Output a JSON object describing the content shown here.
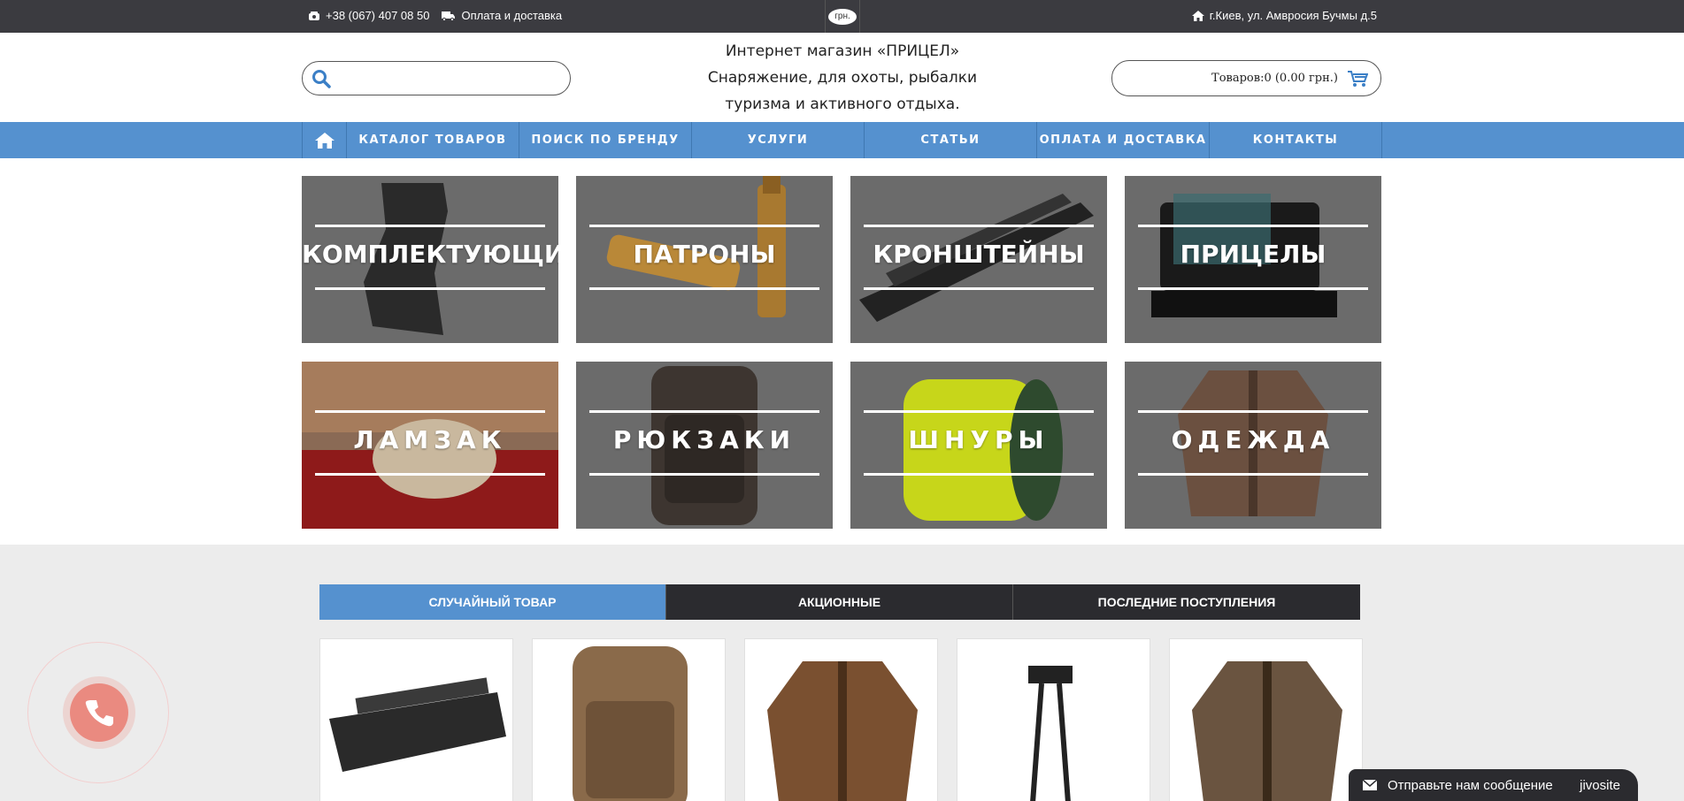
{
  "topbar": {
    "phone": "+38 (067) 407 08 50",
    "delivery": "Оплата и доставка",
    "currency": "грн.",
    "address": "г.Киев, ул. Амвросия Бучмы д.5"
  },
  "header": {
    "tagline_line1": "Интернет магазин «ПРИЦЕЛ»",
    "tagline_line2": "Снаряжение, для охоты, рыбалки",
    "tagline_line3": "туризма и активного отдыха.",
    "search_value": "",
    "cart_text": "Товаров:0 (0.00 грн.)"
  },
  "nav": {
    "items": [
      {
        "label": "КАТАЛОГ ТОВАРОВ"
      },
      {
        "label": "ПОИСК ПО БРЕНДУ"
      },
      {
        "label": "УСЛУГИ"
      },
      {
        "label": "СТАТЬИ"
      },
      {
        "label": "ОПЛАТА И ДОСТАВКА"
      },
      {
        "label": "КОНТАКТЫ"
      }
    ]
  },
  "categories": [
    {
      "label": "КОМПЛЕКТУЮЩИЕ"
    },
    {
      "label": "ПАТРОНЫ"
    },
    {
      "label": "КРОНШТЕЙНЫ"
    },
    {
      "label": "ПРИЦЕЛЫ"
    },
    {
      "label": "ЛАМЗАК"
    },
    {
      "label": "РЮКЗАКИ"
    },
    {
      "label": "ШНУРЫ"
    },
    {
      "label": "ОДЕЖДА"
    }
  ],
  "product_tabs": [
    {
      "label": "СЛУЧАЙНЫЙ ТОВАР"
    },
    {
      "label": "АКЦИОННЫЕ"
    },
    {
      "label": "ПОСЛЕДНИЕ ПОСТУПЛЕНИЯ"
    }
  ],
  "products": [
    {
      "icon": "handguard-image"
    },
    {
      "icon": "camo-backpack-image"
    },
    {
      "icon": "camo-jacket-image"
    },
    {
      "icon": "bipod-image"
    },
    {
      "icon": "camo-jacket-image"
    }
  ],
  "chat": {
    "label": "Отправьте нам сообщение",
    "brand": "jivosite"
  },
  "colors": {
    "accent": "#5591cf",
    "topbar": "#3b3b40",
    "dark_tab": "#2b2b2f",
    "call": "#ea8a80"
  }
}
